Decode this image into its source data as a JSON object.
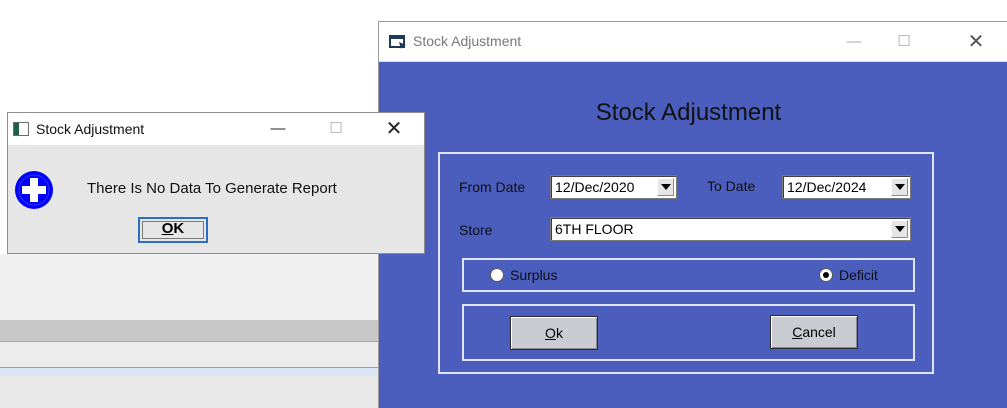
{
  "main_window": {
    "title": "Stock Adjustment",
    "heading": "Stock Adjustment",
    "from_date_label": "From Date",
    "from_date_value": "12/Dec/2020",
    "to_date_label": "To Date",
    "to_date_value": "12/Dec/2024",
    "store_label": "Store",
    "store_value": "6TH FLOOR",
    "radio_surplus": "Surplus",
    "radio_deficit": "Deficit",
    "selected_radio": "Deficit",
    "ok_label": "k",
    "ok_mnemonic": "O",
    "cancel_label": "ancel",
    "cancel_mnemonic": "C",
    "colors": {
      "panel": "#4b5ebd",
      "frame": "#dfe3f4"
    }
  },
  "message_box": {
    "title": "Stock Adjustment",
    "message": "There Is No Data To Generate Report",
    "ok_label": "K",
    "ok_mnemonic": "O",
    "icon": "info-plus-icon"
  },
  "window_controls": {
    "minimize": "—",
    "maximize": "☐",
    "close": "✕"
  }
}
